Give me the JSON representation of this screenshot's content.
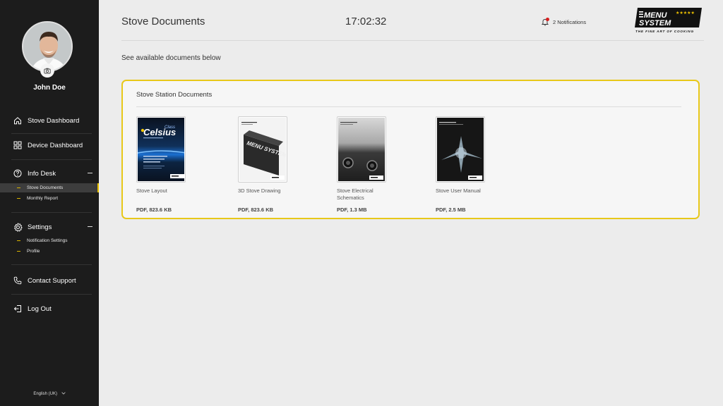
{
  "user": {
    "name": "John Doe"
  },
  "sidebar": {
    "items": [
      {
        "label": "Stove Dashboard"
      },
      {
        "label": "Device Dashboard"
      },
      {
        "label": "Info Desk"
      },
      {
        "label": "Settings"
      },
      {
        "label": "Contact Support"
      },
      {
        "label": "Log Out"
      }
    ],
    "info_desk_sub": [
      {
        "label": "Stove Documents",
        "active": true
      },
      {
        "label": "Monthly Report",
        "active": false
      }
    ],
    "settings_sub": [
      {
        "label": "Notification Settings"
      },
      {
        "label": "Profile"
      }
    ],
    "language": "English (UK)"
  },
  "header": {
    "title": "Stove Documents",
    "time": "17:02:32",
    "notifications": "2 Notifications",
    "logo": {
      "line1": "MENU",
      "line2": "SYSTEM",
      "tagline": "THE FINE ART OF COOKING",
      "stars": "★★★★★"
    }
  },
  "main": {
    "subtitle": "See available documents below",
    "card_title": "Stove Station Documents",
    "documents": [
      {
        "name": "Stove Layout",
        "meta": "PDF, 823.6 KB",
        "cover_title": "Celsius",
        "cover_tag": "Class"
      },
      {
        "name": "3D Stove Drawing",
        "meta": "PDF, 823.6 KB",
        "cover_title": "MENU SYSTEM"
      },
      {
        "name": "Stove Electrical Schematics",
        "meta": "PDF, 1.3 MB"
      },
      {
        "name": "Stove User Manual",
        "meta": "PDF, 2.5 MB"
      }
    ]
  },
  "colors": {
    "accent": "#e8c81a",
    "sidebar_bg": "#1c1c1c",
    "notif_dot": "#d81e1e"
  }
}
